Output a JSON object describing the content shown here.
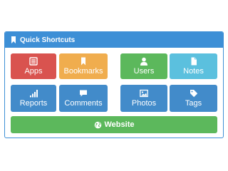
{
  "panel": {
    "title": "Quick Shortcuts",
    "title_icon": "bookmark-icon"
  },
  "tiles": [
    {
      "label": "Apps",
      "icon": "list-icon",
      "color": "#d9534f"
    },
    {
      "label": "Bookmarks",
      "icon": "bookmark-icon",
      "color": "#f0ad4e"
    },
    {
      "label": "Users",
      "icon": "user-icon",
      "color": "#5cb85c"
    },
    {
      "label": "Notes",
      "icon": "file-icon",
      "color": "#5bc0de"
    },
    {
      "label": "Reports",
      "icon": "signal-icon",
      "color": "#428bca"
    },
    {
      "label": "Comments",
      "icon": "comment-icon",
      "color": "#428bca"
    },
    {
      "label": "Photos",
      "icon": "picture-icon",
      "color": "#428bca"
    },
    {
      "label": "Tags",
      "icon": "tag-icon",
      "color": "#428bca"
    }
  ],
  "website_button": {
    "label": "Website",
    "icon": "globe-icon",
    "color": "#5cb85c"
  },
  "colors": {
    "header": "#3d8fd6",
    "border": "#3d8fd6"
  }
}
